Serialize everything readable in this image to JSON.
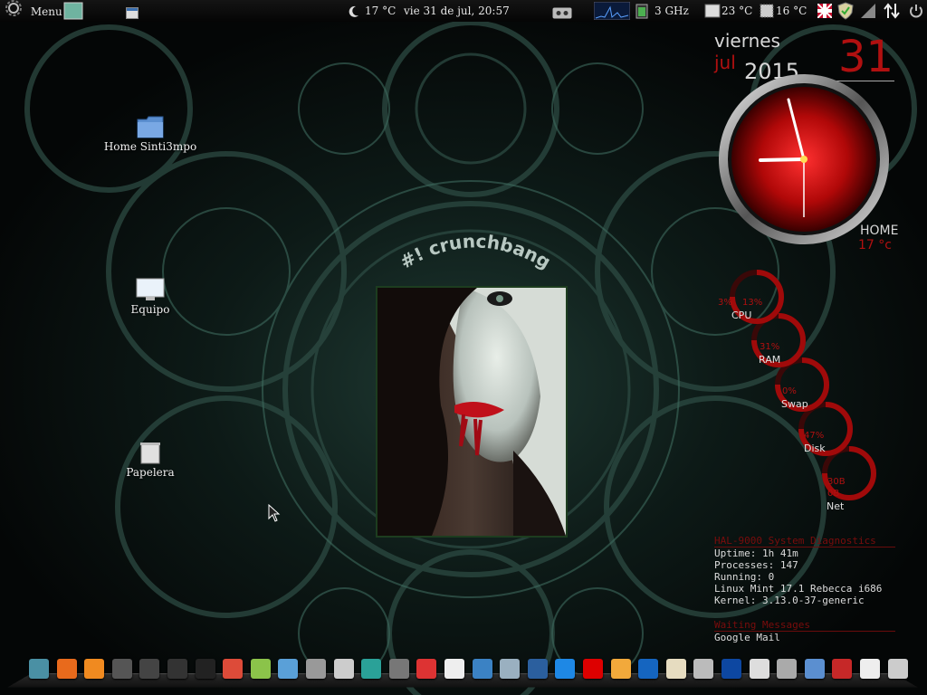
{
  "top_panel": {
    "menu_label": "Menu",
    "weather": "17 °C",
    "datetime": "vie 31 de jul, 20:57",
    "cpu_freq": "3 GHz",
    "temp1": "23 °C",
    "temp2": "16 °C"
  },
  "desktop": {
    "icons": [
      {
        "label": "Home Sinti3mpo",
        "icon": "folder-icon"
      },
      {
        "label": "Equipo",
        "icon": "computer-icon"
      },
      {
        "label": "Papelera",
        "icon": "trash-icon"
      }
    ]
  },
  "wallpaper": {
    "logo_text": "#! crunchbang"
  },
  "conky": {
    "day_name": "viernes",
    "month": "jul",
    "year": "2015",
    "day_number": "31",
    "home_label": "HOME",
    "home_temp": "17 °c",
    "rings": {
      "cpu": {
        "label": "CPU",
        "values": [
          "3%",
          "13%"
        ]
      },
      "ram": {
        "label": "RAM",
        "values": [
          "31%"
        ]
      },
      "swap": {
        "label": "Swap",
        "values": [
          "0%"
        ]
      },
      "disk": {
        "label": "Disk",
        "values": [
          "47%"
        ]
      },
      "net": {
        "label": "Net",
        "values": [
          "30B",
          "0B"
        ]
      }
    },
    "diagnostics": {
      "header": "HAL-9000 System Diagnostics",
      "uptime": "Uptime: 1h 41m",
      "processes": "Processes: 147",
      "running": "Running: 0",
      "os": "Linux Mint 17.1 Rebecca  i686",
      "kernel": "Kernel: 3.13.0-37-generic",
      "messages_header": "Waiting Messages",
      "mail": "Google Mail"
    },
    "accent_color": "#b01010"
  },
  "dock": {
    "icons": [
      "anchor-icon",
      "firefox-icon",
      "ubuntu-one-icon",
      "terminal-icon",
      "calculator-icon",
      "media-player-icon",
      "record-icon",
      "chrome-icon",
      "notes-icon",
      "mail-icon",
      "camera-icon",
      "scanner-icon",
      "mint-icon",
      "recycle-icon",
      "chart-icon",
      "downloads-icon",
      "window-icon",
      "monitor-icon",
      "panel-icon",
      "music-icon",
      "opera-icon",
      "banana-icon",
      "book-icon",
      "document-icon",
      "printer-icon",
      "usb-icon",
      "disk-icon",
      "tape-icon",
      "folder-icon",
      "pdf-icon",
      "text-icon",
      "trash-icon"
    ]
  }
}
